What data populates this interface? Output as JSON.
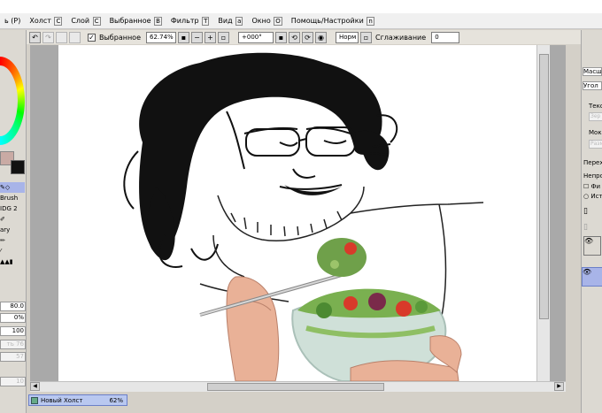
{
  "menu": [
    {
      "label": "Холст",
      "key": "C"
    },
    {
      "label": "Слой",
      "key": "C"
    },
    {
      "label": "Выбранное",
      "key": "B"
    },
    {
      "label": "Фильтр",
      "key": "T"
    },
    {
      "label": "Вид",
      "key": "a"
    },
    {
      "label": "Окно",
      "key": "O"
    },
    {
      "label": "Помощь/Настройки",
      "key": "n"
    }
  ],
  "menu_lead_key": "P",
  "toolbar": {
    "selection_label": "Выбранное",
    "selection_checked": true,
    "zoom_value": "62.74%",
    "rotation_value": "+000°",
    "blend_mode": "Норм",
    "smoothing_label": "Сглаживание",
    "smoothing_value": "0"
  },
  "left_panel": {
    "tools": [
      "",
      "Brush",
      "IDG 2",
      "",
      "ary",
      "",
      "",
      ""
    ],
    "values": [
      "80.0",
      "0%",
      "100",
      "ть 76",
      "57",
      "10"
    ]
  },
  "right_panel": {
    "labels": [
      "Масш",
      "Угол",
      "Текст",
      "Мокр",
      "Перехо",
      "Непрозр",
      "Фи",
      "Ист"
    ],
    "dim_fields": [
      "Зер",
      "Разм"
    ]
  },
  "document": {
    "name": "Новый Холст",
    "zoom": "62%"
  },
  "colors": {
    "primary_swatch": "#c9aaa4",
    "secondary_swatch": "#111111",
    "selection_accent": "#a8b4e8"
  }
}
